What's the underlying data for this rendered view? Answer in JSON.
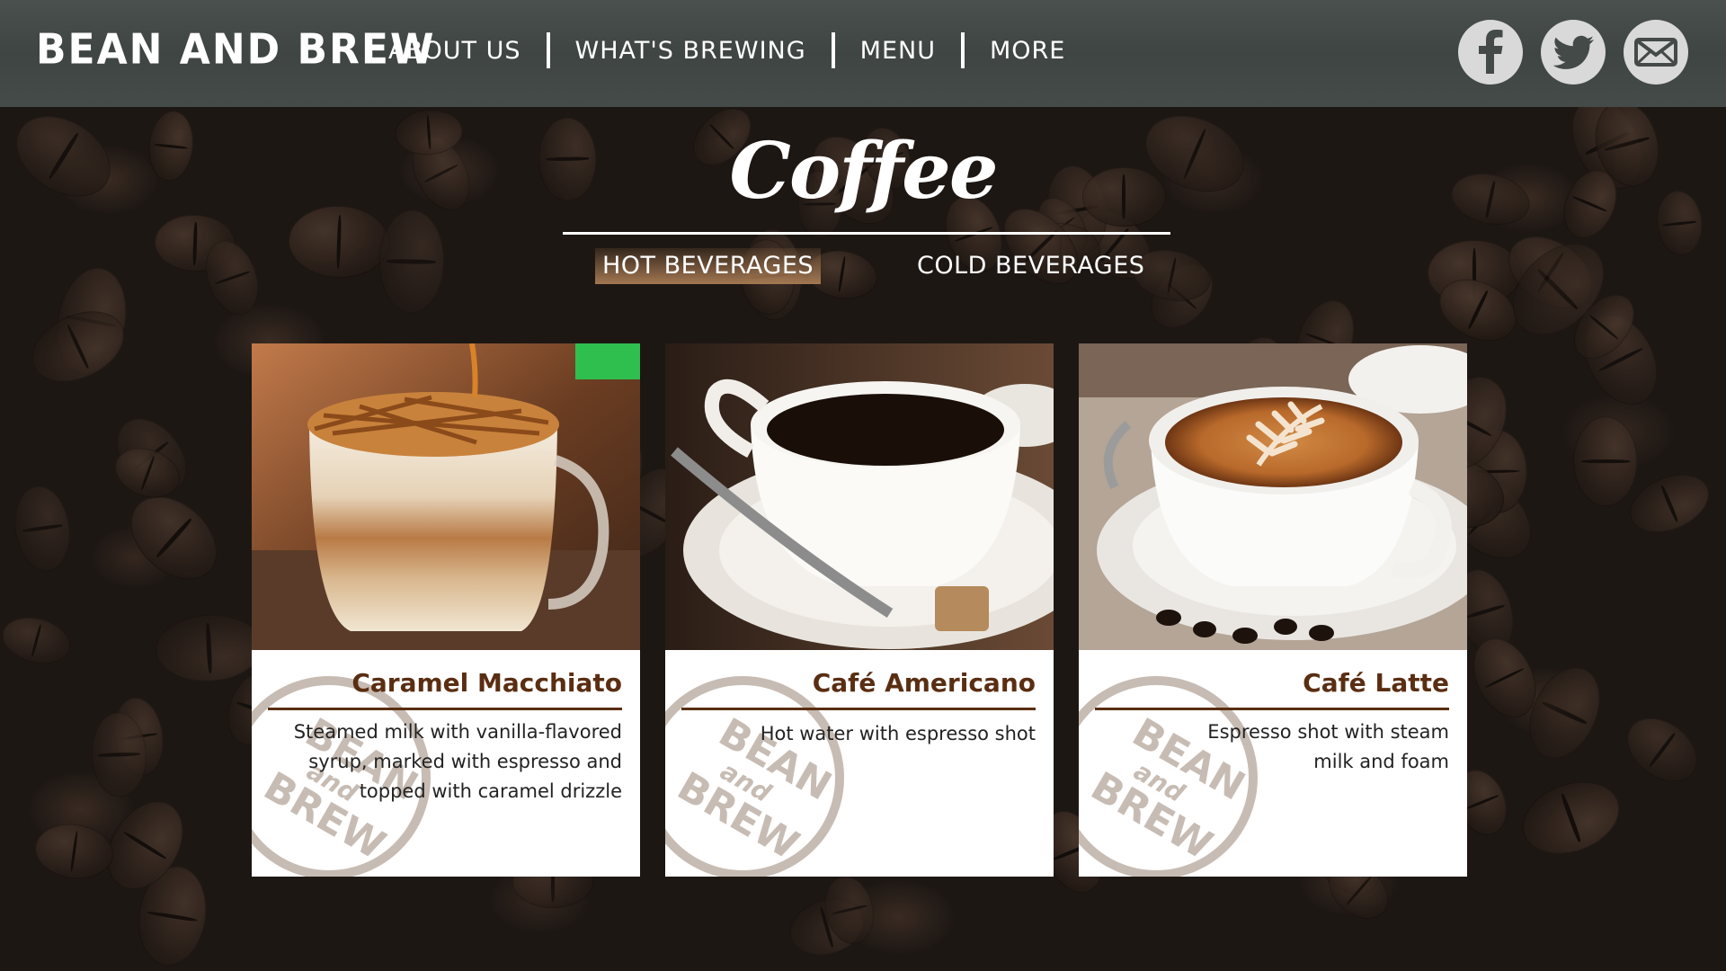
{
  "brand": "BEAN AND BREW",
  "nav": {
    "items": [
      {
        "label": "ABOUT US"
      },
      {
        "label": "WHAT'S BREWING"
      },
      {
        "label": "MENU"
      },
      {
        "label": "MORE"
      }
    ]
  },
  "social": [
    {
      "icon": "facebook-icon"
    },
    {
      "icon": "twitter-icon"
    },
    {
      "icon": "mail-icon"
    }
  ],
  "page_title": "Coffee",
  "tabs": {
    "hot": "HOT BEVERAGES",
    "cold": "COLD BEVERAGES",
    "active": "HOT BEVERAGES"
  },
  "watermark_text": "BEAN and BREW",
  "cards": [
    {
      "name": "Caramel Macchiato",
      "description": "Steamed milk with vanilla-flavored syrup, marked with espresso and topped with caramel drizzle"
    },
    {
      "name": "Café Americano",
      "description": "Hot water with espresso shot"
    },
    {
      "name": "Café Latte",
      "description": "Espresso shot with steam milk and foam"
    }
  ],
  "colors": {
    "header_bg": "#454b48",
    "accent_brown": "#5a2e12",
    "tab_active": "#aa7d55"
  }
}
